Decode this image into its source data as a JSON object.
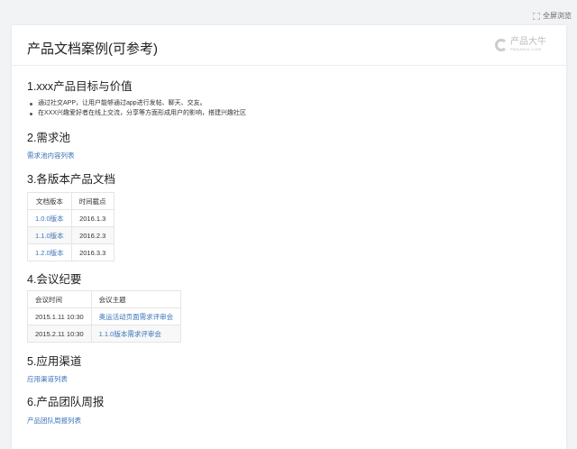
{
  "toolbar": {
    "fullscreen_label": "全屏浏览"
  },
  "header": {
    "title": "产品文档案例(可参考)",
    "logo_text": "产品大牛",
    "logo_sub": "PMDANIU.COM"
  },
  "sections": [
    {
      "heading": "1.xxx产品目标与价值",
      "bullets": [
        "通过社交APP，让用户能够通过app进行发帖、聊天、交友。",
        "在XXX兴趣爱好者在线上交流，分享等方面形成用户的影响，搭建兴趣社区"
      ]
    },
    {
      "heading": "2.需求池",
      "link": "需求池内容列表"
    },
    {
      "heading": "3.各版本产品文档",
      "table": {
        "headers": [
          "文档版本",
          "时间截点"
        ],
        "rows": [
          [
            "1.0.0版本",
            "2016.1.3"
          ],
          [
            "1.1.0版本",
            "2016.2.3"
          ],
          [
            "1.2.0版本",
            "2016.3.3"
          ]
        ]
      }
    },
    {
      "heading": "4.会议纪要",
      "table": {
        "headers": [
          "会议时间",
          "会议主题"
        ],
        "rows": [
          [
            "2015.1.11 10:30",
            "奥运活动页面需求评审会"
          ],
          [
            "2015.2.11 10:30",
            "1.1.0版本需求评审会"
          ]
        ]
      }
    },
    {
      "heading": "5.应用渠道",
      "link": "应用渠道列表"
    },
    {
      "heading": "6.产品团队周报",
      "link": "产品团队周报列表"
    }
  ],
  "colors": {
    "background": "#f2f3f5",
    "link": "#3b73b9"
  }
}
